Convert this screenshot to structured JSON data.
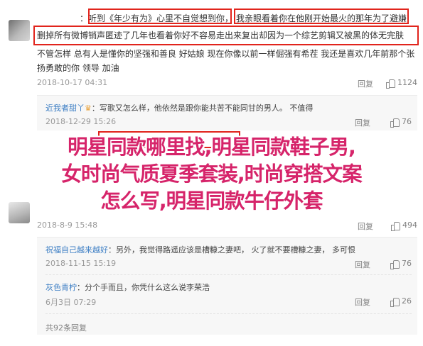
{
  "comment1": {
    "line1_prefix": "：",
    "line1_boxed": "听到《年少有为》心里不自觉想到你",
    "line1_tail": "，",
    "line1_boxed2": "我亲眼看着你在他刚开始最火的那年为了避嫌",
    "line2": "删掉所有微博销声匿迹了几年也看着你好不容易走出来复出却因为一个综艺剪辑又被黑的体无完肤",
    "line3": "不管怎样  总有人是懂你的坚强和善良  好姑娘  现在你像以前一样倔强有希茬  我还是喜欢几年前那个张",
    "line4": "扬勇敢的你  领导  加油",
    "time": "2018-10-17 04:31",
    "reply": "回复",
    "likes": "1124"
  },
  "reply1": {
    "user": "近我者甜丫",
    "text": "：写歌又怎么样，他依然是跟你能共苦不能同甘的男人。  不值得",
    "time": "2018-12-29 15:26",
    "reply": "回复",
    "likes": "76"
  },
  "comment2": {
    "time": "2018-8-9 15:48",
    "reply": "回复",
    "likes": "494"
  },
  "reply2": {
    "user": "祝福自己越来越好",
    "text": "：另外，我觉得路遥应该是槽糠之妻吧，  火了就不要槽糠之妻，  多可恨",
    "time": "2018-11-15 15:19",
    "reply": "回复",
    "likes": "76"
  },
  "reply3": {
    "user": "灰色青柠",
    "text": "：分个手而且，你凭什么这么说李荣浩",
    "time": "6月3日 07:29",
    "reply": "回复",
    "likes": "26"
  },
  "more_replies": "共92条回复",
  "overlay": {
    "line1": "明星同款哪里找,明星同款鞋子男,",
    "line2": "女时尚气质夏季套装,时尚穿搭文案",
    "line3": "怎么写,明星同款牛仔外套"
  },
  "colors": {
    "highlight_box": "#e1241c",
    "overlay_text": "#d6246a",
    "username": "#eb7350"
  }
}
